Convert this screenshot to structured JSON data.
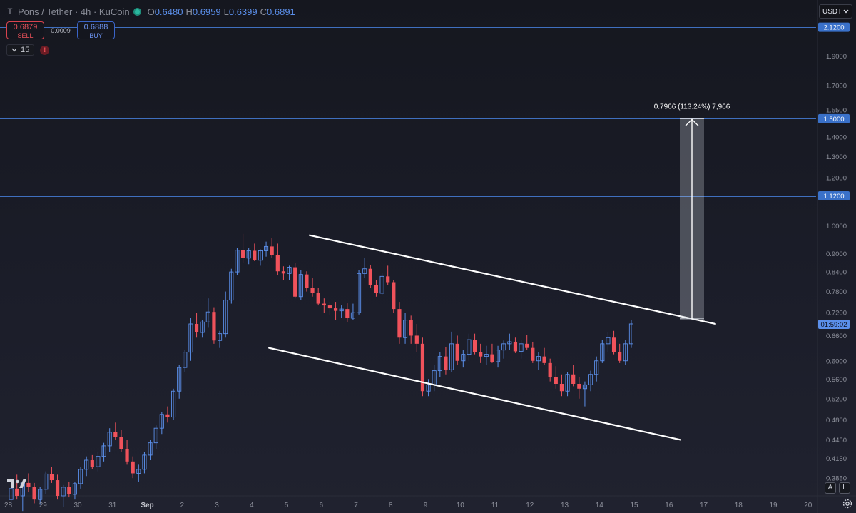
{
  "header": {
    "logo_glyph": "T",
    "symbol": "Pons / Tether · 4h · KuCoin",
    "status_dot_color": "#2ab89f",
    "ohlc": [
      {
        "key": "O",
        "value": "0.6480"
      },
      {
        "key": "H",
        "value": "0.6959"
      },
      {
        "key": "L",
        "value": "0.6399"
      },
      {
        "key": "C",
        "value": "0.6891"
      }
    ]
  },
  "trade": {
    "sell_price": "0.6879",
    "sell_label": "SELL",
    "spread": "0.0009",
    "buy_price": "0.6888",
    "buy_label": "BUY"
  },
  "indicators": {
    "count": "15",
    "warning_glyph": "!"
  },
  "currency": {
    "label": "USDT",
    "icon": "chevron-down-icon"
  },
  "corner": {
    "auto_label": "A",
    "log_label": "L",
    "settings_icon": "gear-icon"
  },
  "colors": {
    "up": "#5b8fea",
    "down": "#f0525b",
    "level_line": "#3f6fbf",
    "label_bg": "#3a71c9",
    "countdown_bg": "#5b8fea",
    "channel": "#ffffff"
  },
  "chart_data": {
    "type": "candlestick",
    "scale": "log",
    "title": "Pons / Tether · 4h · KuCoin",
    "ylim": [
      0.36,
      2.35
    ],
    "y_ticks": [
      "1.9000",
      "1.7000",
      "1.5500",
      "1.4000",
      "1.3000",
      "1.2000",
      "1.0000",
      "0.9000",
      "0.8400",
      "0.7800",
      "0.7200",
      "0.6600",
      "0.6000",
      "0.5600",
      "0.5200",
      "0.4800",
      "0.4450",
      "0.4150",
      "0.3850"
    ],
    "x_ticks": [
      "28",
      "29",
      "30",
      "31",
      "Sep",
      "2",
      "3",
      "4",
      "5",
      "6",
      "7",
      "8",
      "9",
      "10",
      "11",
      "12",
      "13",
      "14",
      "15",
      "16",
      "17",
      "18",
      "19",
      "20"
    ],
    "x_start_day": 28,
    "candles_per_day": 6,
    "candles": [
      [
        0.355,
        0.375,
        0.345,
        0.37
      ],
      [
        0.37,
        0.39,
        0.355,
        0.36
      ],
      [
        0.36,
        0.38,
        0.34,
        0.378
      ],
      [
        0.378,
        0.392,
        0.365,
        0.372
      ],
      [
        0.372,
        0.378,
        0.35,
        0.355
      ],
      [
        0.355,
        0.372,
        0.348,
        0.369
      ],
      [
        0.369,
        0.395,
        0.362,
        0.391
      ],
      [
        0.391,
        0.402,
        0.378,
        0.382
      ],
      [
        0.382,
        0.39,
        0.355,
        0.36
      ],
      [
        0.36,
        0.375,
        0.345,
        0.372
      ],
      [
        0.372,
        0.38,
        0.358,
        0.362
      ],
      [
        0.362,
        0.38,
        0.355,
        0.377
      ],
      [
        0.377,
        0.402,
        0.37,
        0.398
      ],
      [
        0.398,
        0.418,
        0.388,
        0.412
      ],
      [
        0.412,
        0.42,
        0.398,
        0.402
      ],
      [
        0.402,
        0.425,
        0.395,
        0.418
      ],
      [
        0.418,
        0.44,
        0.41,
        0.435
      ],
      [
        0.435,
        0.465,
        0.425,
        0.458
      ],
      [
        0.458,
        0.475,
        0.445,
        0.45
      ],
      [
        0.45,
        0.462,
        0.425,
        0.43
      ],
      [
        0.43,
        0.445,
        0.405,
        0.41
      ],
      [
        0.41,
        0.418,
        0.385,
        0.392
      ],
      [
        0.392,
        0.405,
        0.38,
        0.398
      ],
      [
        0.398,
        0.425,
        0.392,
        0.42
      ],
      [
        0.42,
        0.445,
        0.412,
        0.44
      ],
      [
        0.44,
        0.47,
        0.43,
        0.465
      ],
      [
        0.465,
        0.495,
        0.455,
        0.49
      ],
      [
        0.49,
        0.505,
        0.475,
        0.485
      ],
      [
        0.485,
        0.54,
        0.48,
        0.535
      ],
      [
        0.535,
        0.59,
        0.52,
        0.585
      ],
      [
        0.585,
        0.625,
        0.575,
        0.62
      ],
      [
        0.62,
        0.705,
        0.6,
        0.69
      ],
      [
        0.69,
        0.72,
        0.655,
        0.668
      ],
      [
        0.668,
        0.7,
        0.655,
        0.695
      ],
      [
        0.695,
        0.76,
        0.68,
        0.722
      ],
      [
        0.722,
        0.735,
        0.64,
        0.648
      ],
      [
        0.648,
        0.672,
        0.63,
        0.665
      ],
      [
        0.665,
        0.78,
        0.655,
        0.755
      ],
      [
        0.755,
        0.85,
        0.745,
        0.84
      ],
      [
        0.84,
        0.92,
        0.83,
        0.912
      ],
      [
        0.912,
        0.97,
        0.87,
        0.885
      ],
      [
        0.885,
        0.92,
        0.865,
        0.91
      ],
      [
        0.91,
        0.935,
        0.875,
        0.878
      ],
      [
        0.878,
        0.915,
        0.86,
        0.91
      ],
      [
        0.91,
        0.942,
        0.89,
        0.925
      ],
      [
        0.925,
        0.955,
        0.885,
        0.895
      ],
      [
        0.895,
        0.935,
        0.83,
        0.842
      ],
      [
        0.842,
        0.858,
        0.815,
        0.835
      ],
      [
        0.835,
        0.86,
        0.815,
        0.855
      ],
      [
        0.855,
        0.87,
        0.76,
        0.765
      ],
      [
        0.765,
        0.845,
        0.755,
        0.832
      ],
      [
        0.832,
        0.842,
        0.78,
        0.79
      ],
      [
        0.79,
        0.82,
        0.765,
        0.775
      ],
      [
        0.775,
        0.79,
        0.74,
        0.745
      ],
      [
        0.745,
        0.76,
        0.72,
        0.74
      ],
      [
        0.74,
        0.75,
        0.715,
        0.732
      ],
      [
        0.732,
        0.75,
        0.7,
        0.725
      ],
      [
        0.725,
        0.74,
        0.705,
        0.73
      ],
      [
        0.73,
        0.746,
        0.695,
        0.705
      ],
      [
        0.705,
        0.745,
        0.7,
        0.72
      ],
      [
        0.72,
        0.845,
        0.715,
        0.835
      ],
      [
        0.835,
        0.885,
        0.82,
        0.85
      ],
      [
        0.85,
        0.862,
        0.79,
        0.8
      ],
      [
        0.8,
        0.815,
        0.765,
        0.775
      ],
      [
        0.775,
        0.838,
        0.77,
        0.826
      ],
      [
        0.826,
        0.86,
        0.8,
        0.808
      ],
      [
        0.808,
        0.815,
        0.72,
        0.73
      ],
      [
        0.73,
        0.75,
        0.64,
        0.655
      ],
      [
        0.655,
        0.72,
        0.64,
        0.7
      ],
      [
        0.7,
        0.712,
        0.64,
        0.66
      ],
      [
        0.66,
        0.69,
        0.62,
        0.64
      ],
      [
        0.64,
        0.655,
        0.525,
        0.535
      ],
      [
        0.535,
        0.56,
        0.525,
        0.548
      ],
      [
        0.548,
        0.59,
        0.535,
        0.578
      ],
      [
        0.578,
        0.62,
        0.565,
        0.61
      ],
      [
        0.61,
        0.632,
        0.57,
        0.58
      ],
      [
        0.58,
        0.67,
        0.575,
        0.64
      ],
      [
        0.64,
        0.66,
        0.59,
        0.6
      ],
      [
        0.6,
        0.625,
        0.585,
        0.615
      ],
      [
        0.615,
        0.665,
        0.6,
        0.65
      ],
      [
        0.65,
        0.665,
        0.615,
        0.62
      ],
      [
        0.62,
        0.64,
        0.595,
        0.61
      ],
      [
        0.61,
        0.635,
        0.59,
        0.615
      ],
      [
        0.615,
        0.64,
        0.595,
        0.598
      ],
      [
        0.598,
        0.635,
        0.585,
        0.625
      ],
      [
        0.625,
        0.648,
        0.605,
        0.64
      ],
      [
        0.64,
        0.665,
        0.625,
        0.645
      ],
      [
        0.645,
        0.655,
        0.618,
        0.622
      ],
      [
        0.622,
        0.65,
        0.605,
        0.64
      ],
      [
        0.64,
        0.662,
        0.625,
        0.63
      ],
      [
        0.63,
        0.645,
        0.595,
        0.6
      ],
      [
        0.6,
        0.62,
        0.58,
        0.61
      ],
      [
        0.61,
        0.63,
        0.59,
        0.595
      ],
      [
        0.595,
        0.605,
        0.555,
        0.565
      ],
      [
        0.565,
        0.588,
        0.54,
        0.55
      ],
      [
        0.55,
        0.57,
        0.525,
        0.535
      ],
      [
        0.535,
        0.575,
        0.525,
        0.57
      ],
      [
        0.57,
        0.59,
        0.545,
        0.55
      ],
      [
        0.55,
        0.565,
        0.52,
        0.54
      ],
      [
        0.54,
        0.555,
        0.505,
        0.548
      ],
      [
        0.548,
        0.578,
        0.535,
        0.57
      ],
      [
        0.57,
        0.61,
        0.555,
        0.6
      ],
      [
        0.6,
        0.65,
        0.595,
        0.64
      ],
      [
        0.64,
        0.67,
        0.62,
        0.655
      ],
      [
        0.655,
        0.672,
        0.615,
        0.62
      ],
      [
        0.62,
        0.64,
        0.595,
        0.6
      ],
      [
        0.6,
        0.65,
        0.59,
        0.64
      ],
      [
        0.64,
        0.7,
        0.63,
        0.69
      ]
    ],
    "horizontal_levels": [
      "2.1200",
      "1.5000",
      "1.1200"
    ],
    "current_price_label": "0.6891",
    "countdown": "01:59:02",
    "channel": {
      "upper": [
        [
          "09-05 16:00",
          0.965
        ],
        [
          "09-17 08:00",
          0.69
        ]
      ],
      "lower": [
        [
          "09-04 12:00",
          0.63
        ],
        [
          "09-16 08:00",
          0.445
        ]
      ]
    },
    "measure": {
      "label": "0.7966 (113.24%) 7,966",
      "from_price": 0.7034,
      "to_price": 1.5
    }
  }
}
